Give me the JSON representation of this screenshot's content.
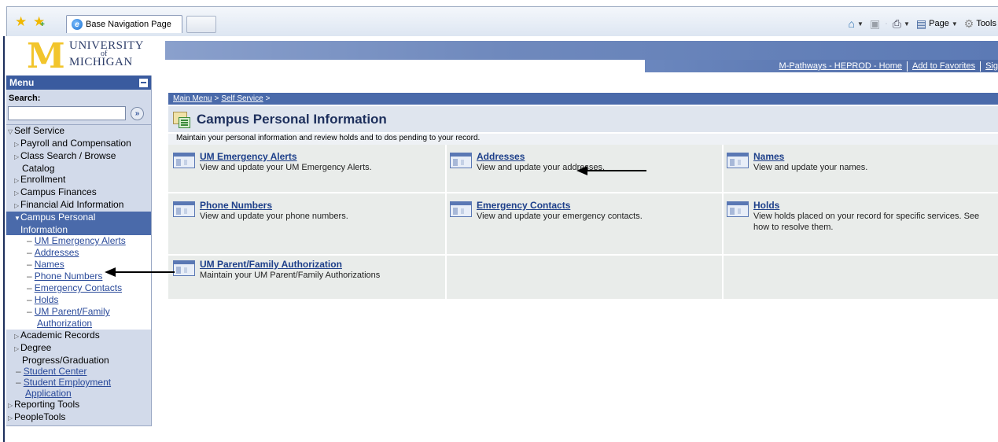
{
  "browser": {
    "tab_title": "Base Navigation Page",
    "commands": [
      "Page",
      "Tools"
    ]
  },
  "header": {
    "logo": {
      "line1": "UNIVERSITY",
      "line2": "of",
      "line3": "MICHIGAN"
    },
    "links": [
      "M-Pathways - HEPROD - Home",
      "Add to Favorites",
      "Sig"
    ]
  },
  "menu": {
    "title": "Menu",
    "search_label": "Search:",
    "items": {
      "self_service": "Self Service",
      "payroll": "Payroll and Compensation",
      "class_search_1": "Class Search / Browse",
      "class_search_2": "Catalog",
      "enrollment": "Enrollment",
      "campus_finances": "Campus Finances",
      "financial_aid": "Financial Aid Information",
      "campus_personal_1": "Campus Personal",
      "campus_personal_2": "Information",
      "sub": [
        "UM Emergency Alerts",
        "Addresses",
        "Names",
        "Phone Numbers",
        "Emergency Contacts",
        "Holds"
      ],
      "sub_parent_1": "UM Parent/Family",
      "sub_parent_2": "Authorization",
      "academic_records": "Academic Records",
      "degree_1": "Degree",
      "degree_2": "Progress/Graduation",
      "student_center": "Student Center",
      "student_employment_1": "Student Employment",
      "student_employment_2": "Application",
      "reporting_tools": "Reporting Tools",
      "peopletools": "PeopleTools"
    }
  },
  "main": {
    "breadcrumb": {
      "main_menu": "Main Menu",
      "sep1": ">",
      "self_service": "Self Service",
      "sep2": ">"
    },
    "title": "Campus Personal Information",
    "description": "Maintain your personal information and review holds and to dos pending to your record.",
    "items": [
      {
        "title": "UM Emergency Alerts",
        "desc": "View and update your UM Emergency Alerts."
      },
      {
        "title": "Addresses",
        "desc": "View and update your addresses."
      },
      {
        "title": "Names",
        "desc": "View and update your names."
      },
      {
        "title": "Phone Numbers",
        "desc": "View and update your phone numbers."
      },
      {
        "title": "Emergency Contacts",
        "desc": "View and update your emergency contacts."
      },
      {
        "title": "Holds",
        "desc": "View holds placed on your record for specific services. See how to resolve them."
      },
      {
        "title": "UM Parent/Family Authorization",
        "desc": "Maintain your UM Parent/Family Authorizations"
      }
    ]
  }
}
